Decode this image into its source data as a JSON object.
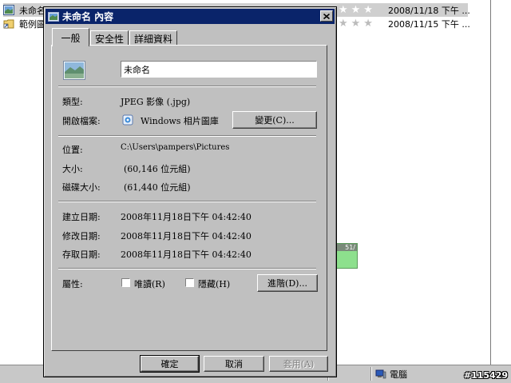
{
  "background": {
    "rows": [
      {
        "name": "未命名",
        "date": "2008/11/18 下午 ...",
        "selected": true
      },
      {
        "name": "範例圖",
        "date": "2008/11/15 下午 ...",
        "selected": false
      }
    ],
    "rating_stars": "★★★",
    "status_computer": "電腦",
    "indicator_text": "51/",
    "watermark": "#115429"
  },
  "dialog": {
    "title": "未命名 內容",
    "tabs": [
      "一般",
      "安全性",
      "詳細資料"
    ],
    "file_name_value": "未命名",
    "type_label": "類型:",
    "type_value": "JPEG 影像 (.jpg)",
    "opens_with_label": "開啟檔案:",
    "opens_with_value": "Windows 相片圖庫",
    "change_button": "變更(C)...",
    "location_label": "位置:",
    "location_value": "C:\\Users\\pampers\\Pictures",
    "size_label": "大小:",
    "size_value": "(60,146 位元組)",
    "size_on_disk_label": "磁碟大小:",
    "size_on_disk_value": "(61,440 位元組)",
    "created_label": "建立日期:",
    "created_value": "2008年11月18日下午 04:42:40",
    "modified_label": "修改日期:",
    "modified_value": "2008年11月18日下午 04:42:40",
    "accessed_label": "存取日期:",
    "accessed_value": "2008年11月18日下午 04:42:40",
    "attributes_label": "屬性:",
    "readonly_label": "唯讀(R)",
    "hidden_label": "隱藏(H)",
    "advanced_button": "進階(D)...",
    "ok_button": "確定",
    "cancel_button": "取消",
    "apply_button": "套用(A)"
  },
  "colors": {
    "titlebar": "#0a246a",
    "dialog_face": "#c0c0c0"
  }
}
